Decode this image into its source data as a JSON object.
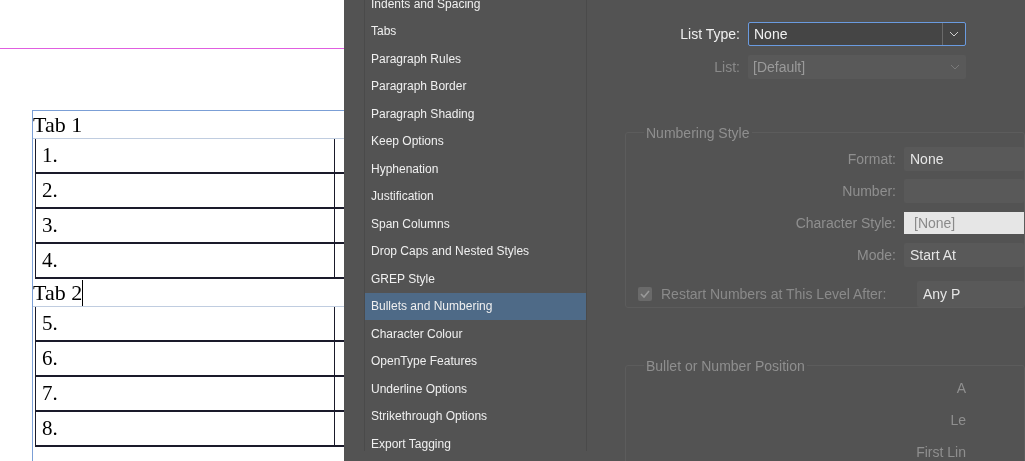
{
  "document": {
    "groups": [
      {
        "heading": "Tab 1",
        "caret": false,
        "rows": [
          "1.",
          "2.",
          "3.",
          "4."
        ]
      },
      {
        "heading": "Tab 2",
        "caret": true,
        "rows": [
          "5.",
          "6.",
          "7.",
          "8."
        ]
      }
    ]
  },
  "sidebar": {
    "items": [
      {
        "label": "Indents and Spacing",
        "selected": false
      },
      {
        "label": "Tabs",
        "selected": false
      },
      {
        "label": "Paragraph Rules",
        "selected": false
      },
      {
        "label": "Paragraph Border",
        "selected": false
      },
      {
        "label": "Paragraph Shading",
        "selected": false
      },
      {
        "label": "Keep Options",
        "selected": false
      },
      {
        "label": "Hyphenation",
        "selected": false
      },
      {
        "label": "Justification",
        "selected": false
      },
      {
        "label": "Span Columns",
        "selected": false
      },
      {
        "label": "Drop Caps and Nested Styles",
        "selected": false
      },
      {
        "label": "GREP Style",
        "selected": false
      },
      {
        "label": "Bullets and Numbering",
        "selected": true
      },
      {
        "label": "Character Colour",
        "selected": false
      },
      {
        "label": "OpenType Features",
        "selected": false
      },
      {
        "label": "Underline Options",
        "selected": false
      },
      {
        "label": "Strikethrough Options",
        "selected": false
      },
      {
        "label": "Export Tagging",
        "selected": false
      }
    ]
  },
  "list_type": {
    "label": "List Type:",
    "value": "None",
    "disabled": false
  },
  "list": {
    "label": "List:",
    "value": "[Default]",
    "disabled": true
  },
  "numbering_style": {
    "title": "Numbering Style",
    "fields": [
      {
        "label": "Format:",
        "value": "None",
        "kind": "dark"
      },
      {
        "label": "Number:",
        "kind": "dark"
      },
      {
        "label": "Character Style:",
        "value": "[None]",
        "kind": "light"
      },
      {
        "label": "Mode:",
        "value": "Start At",
        "kind": "dark"
      }
    ],
    "restart": {
      "label": "Restart Numbers at This Level After:",
      "checked": true,
      "value": "Any P"
    }
  },
  "position": {
    "title": "Bullet or Number Position",
    "labels": [
      "A",
      "Le",
      "First Lin"
    ]
  }
}
